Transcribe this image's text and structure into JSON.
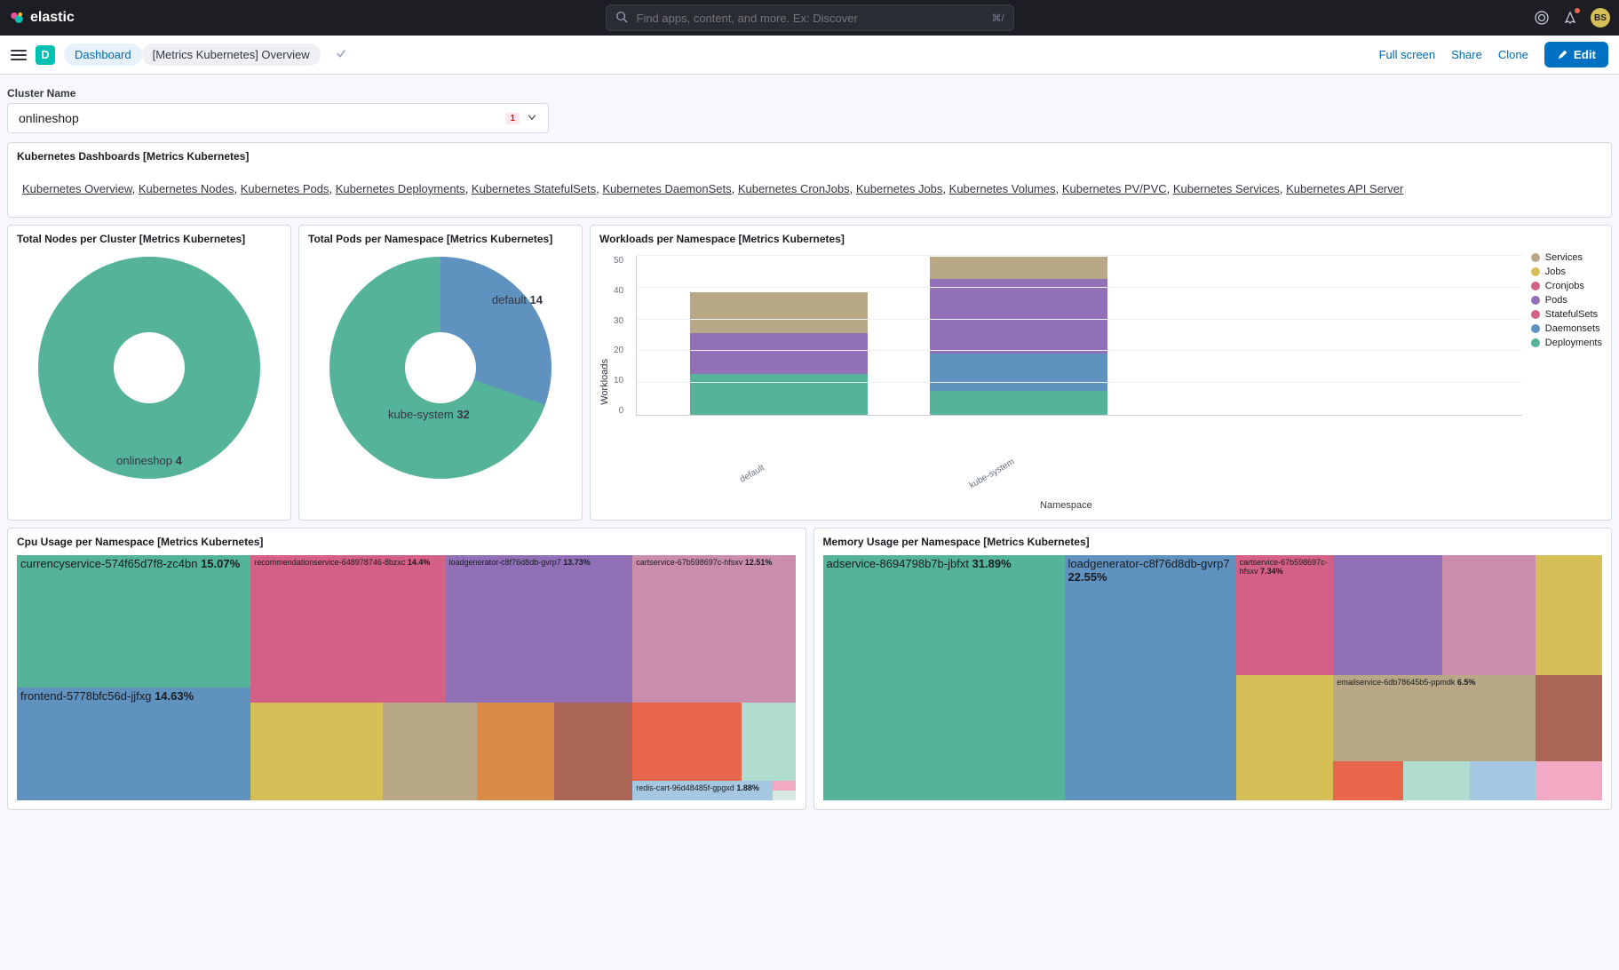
{
  "header": {
    "product": "elastic",
    "search_placeholder": "Find apps, content, and more. Ex: Discover",
    "kbd": "⌘/",
    "avatar": "BS"
  },
  "bar2": {
    "badge": "D",
    "crumb1": "Dashboard",
    "crumb2": "[Metrics Kubernetes] Overview",
    "fullscreen": "Full screen",
    "share": "Share",
    "clone": "Clone",
    "edit": "Edit"
  },
  "cluster": {
    "label": "Cluster Name",
    "name": "onlineshop",
    "count": "1"
  },
  "klinks": {
    "title": "Kubernetes Dashboards [Metrics Kubernetes]",
    "items": [
      "Kubernetes Overview",
      "Kubernetes Nodes",
      "Kubernetes Pods",
      "Kubernetes Deployments",
      "Kubernetes StatefulSets",
      "Kubernetes DaemonSets",
      "Kubernetes CronJobs",
      "Kubernetes Jobs",
      "Kubernetes Volumes",
      "Kubernetes PV/PVC",
      "Kubernetes Services",
      "Kubernetes API Server"
    ]
  },
  "panels": {
    "nodes": {
      "title": "Total Nodes per Cluster [Metrics Kubernetes]",
      "label": "onlineshop",
      "value": "4"
    },
    "pods": {
      "title": "Total Pods per Namespace [Metrics Kubernetes]",
      "l1": "kube-system",
      "v1": "32",
      "l2": "default",
      "v2": "14"
    },
    "workloads": {
      "title": "Workloads per Namespace [Metrics Kubernetes]",
      "ylabel": "Workloads",
      "xlabel": "Namespace"
    },
    "cpu": {
      "title": "Cpu Usage per Namespace [Metrics Kubernetes]"
    },
    "mem": {
      "title": "Memory Usage per Namespace [Metrics Kubernetes]"
    }
  },
  "workloads_legend": [
    "Services",
    "Jobs",
    "Cronjobs",
    "Pods",
    "StatefulSets",
    "Daemonsets",
    "Deployments"
  ],
  "workloads_x": [
    "default",
    "kube-system"
  ],
  "workloads_yticks": [
    "50",
    "40",
    "30",
    "20",
    "10",
    "0"
  ],
  "cpu_tm": {
    "a": {
      "name": "currencyservice-574f65d7f8-zc4bn",
      "pct": "15.07%"
    },
    "b": {
      "name": "recommendationservice-648978746-8bzxc",
      "pct": "14.4%"
    },
    "c": {
      "name": "loadgenerator-c8f76d8db-gvrp7",
      "pct": "13.73%"
    },
    "d": {
      "name": "cartservice-67b598697c-hfsxv",
      "pct": "12.51%"
    },
    "e": {
      "name": "frontend-5778bfc56d-jjfxg",
      "pct": "14.63%"
    },
    "f": {
      "name": "redis-cart-96d48485f-gpgxd",
      "pct": "1.88%"
    }
  },
  "mem_tm": {
    "a": {
      "name": "adservice-8694798b7b-jbfxt",
      "pct": "31.89%"
    },
    "b": {
      "name": "loadgenerator-c8f76d8db-gvrp7",
      "pct": "22.55%"
    },
    "c": {
      "name": "cartservice-67b598697c-hfsxv",
      "pct": "7.34%"
    },
    "d": {
      "name": "emailservice-6db78645b5-ppmdk",
      "pct": "6.5%"
    }
  },
  "chart_data": [
    {
      "type": "pie",
      "title": "Total Nodes per Cluster [Metrics Kubernetes]",
      "categories": [
        "onlineshop"
      ],
      "values": [
        4
      ]
    },
    {
      "type": "pie",
      "title": "Total Pods per Namespace [Metrics Kubernetes]",
      "categories": [
        "kube-system",
        "default"
      ],
      "values": [
        32,
        14
      ]
    },
    {
      "type": "bar",
      "title": "Workloads per Namespace [Metrics Kubernetes]",
      "xlabel": "Namespace",
      "ylabel": "Workloads",
      "ylim": [
        0,
        55
      ],
      "categories": [
        "default",
        "kube-system"
      ],
      "series": [
        {
          "name": "Deployments",
          "values": [
            14,
            8
          ]
        },
        {
          "name": "Daemonsets",
          "values": [
            0,
            13
          ]
        },
        {
          "name": "StatefulSets",
          "values": [
            0,
            0
          ]
        },
        {
          "name": "Pods",
          "values": [
            14,
            25
          ]
        },
        {
          "name": "Cronjobs",
          "values": [
            0,
            0
          ]
        },
        {
          "name": "Jobs",
          "values": [
            0,
            0
          ]
        },
        {
          "name": "Services",
          "values": [
            14,
            8
          ]
        }
      ]
    },
    {
      "type": "treemap",
      "title": "Cpu Usage per Namespace [Metrics Kubernetes]",
      "items": [
        {
          "name": "currencyservice-574f65d7f8-zc4bn",
          "value": 15.07
        },
        {
          "name": "frontend-5778bfc56d-jjfxg",
          "value": 14.63
        },
        {
          "name": "recommendationservice-648978746-8bzxc",
          "value": 14.4
        },
        {
          "name": "loadgenerator-c8f76d8db-gvrp7",
          "value": 13.73
        },
        {
          "name": "cartservice-67b598697c-hfsxv",
          "value": 12.51
        },
        {
          "name": "redis-cart-96d48485f-gpgxd",
          "value": 1.88
        }
      ]
    },
    {
      "type": "treemap",
      "title": "Memory Usage per Namespace [Metrics Kubernetes]",
      "items": [
        {
          "name": "adservice-8694798b7b-jbfxt",
          "value": 31.89
        },
        {
          "name": "loadgenerator-c8f76d8db-gvrp7",
          "value": 22.55
        },
        {
          "name": "cartservice-67b598697c-hfsxv",
          "value": 7.34
        },
        {
          "name": "emailservice-6db78645b5-ppmdk",
          "value": 6.5
        }
      ]
    }
  ]
}
